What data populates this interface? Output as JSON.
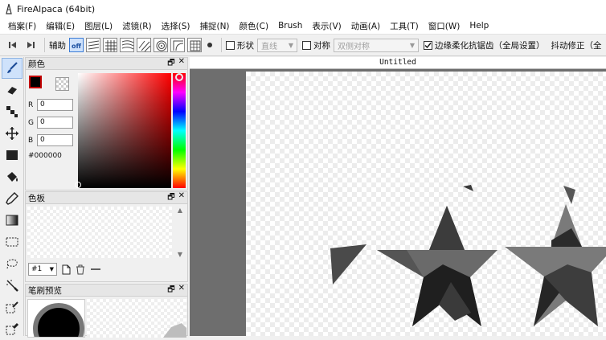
{
  "window": {
    "title": "FireAlpaca (64bit)"
  },
  "menu": [
    "档案(F)",
    "编辑(E)",
    "图层(L)",
    "滤镜(R)",
    "选择(S)",
    "捕捉(N)",
    "颜色(C)",
    "Brush",
    "表示(V)",
    "动画(A)",
    "工具(T)",
    "窗口(W)",
    "Help"
  ],
  "toolbar": {
    "assist_label": "辅助",
    "off_label": "off",
    "shape_label": "形状",
    "shape_value": "直线",
    "symmetry_label": "对称",
    "symmetry_value": "双侧对称",
    "antialias_label": "边缘柔化抗锯齿（全局设置）",
    "correction_label": "抖动修正（全"
  },
  "color_panel": {
    "title": "颜色",
    "r_label": "R",
    "r_value": "0",
    "g_label": "G",
    "g_value": "0",
    "b_label": "B",
    "b_value": "0",
    "hex": "#000000",
    "foreground": "#000000",
    "background": "#ffffff"
  },
  "palette_panel": {
    "title": "色板",
    "selected": "#1"
  },
  "brush_panel": {
    "title": "笔刷预览"
  },
  "document": {
    "title": "Untitled"
  },
  "panel_controls": {
    "restore": "🗗",
    "close": "✕"
  }
}
